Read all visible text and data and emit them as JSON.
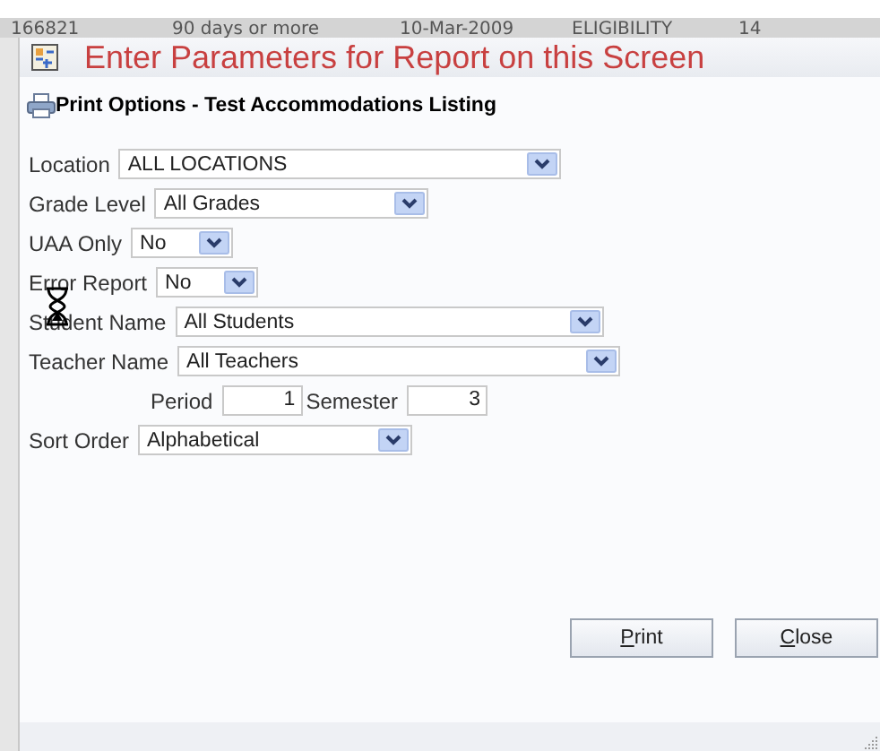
{
  "background_row": [
    "166821",
    "90 days or more",
    "10-Mar-2009",
    "ELIGIBILITY",
    "14"
  ],
  "dialog": {
    "title": "Enter Parameters for Report on this Screen",
    "heading": "Print Options - Test Accommodations Listing",
    "fields": [
      {
        "kind": "select",
        "label": "Location",
        "value": "ALL LOCATIONS"
      },
      {
        "kind": "select",
        "label": "Grade Level",
        "value": "All Grades"
      },
      {
        "kind": "select",
        "label": "UAA Only",
        "value": "No"
      },
      {
        "kind": "select",
        "label": "Error Report",
        "value": "No"
      },
      {
        "kind": "select",
        "label": "Student Name",
        "value": "All Students"
      },
      {
        "kind": "select",
        "label": "Teacher Name",
        "value": "All Teachers"
      },
      {
        "kind": "pair",
        "items": [
          {
            "label": "Period",
            "value": "1"
          },
          {
            "label": "Semester",
            "value": "3"
          }
        ]
      },
      {
        "kind": "select",
        "label": "Sort Order",
        "value": "Alphabetical"
      }
    ],
    "buttons": [
      "Print",
      "Close"
    ]
  }
}
